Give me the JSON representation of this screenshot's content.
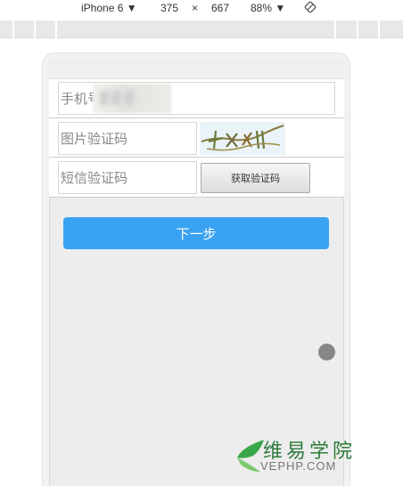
{
  "devtools": {
    "device": "iPhone 6",
    "width": "375",
    "times": "×",
    "height": "667",
    "zoom": "88%",
    "dropdown_icon": "caret-down-icon",
    "rotate_icon": "rotate-icon"
  },
  "form": {
    "phone_placeholder": "手机号",
    "image_code_placeholder": "图片验证码",
    "sms_code_placeholder": "短信验证码",
    "sms_button_label": "获取验证码",
    "next_button_label": "下一步"
  },
  "watermark": {
    "title": "维易学院",
    "subtitle": "VEPHP.COM"
  },
  "colors": {
    "primary_button": "#3aa2f2",
    "float_button": "#878787",
    "watermark_green": "#2d7a3a"
  }
}
